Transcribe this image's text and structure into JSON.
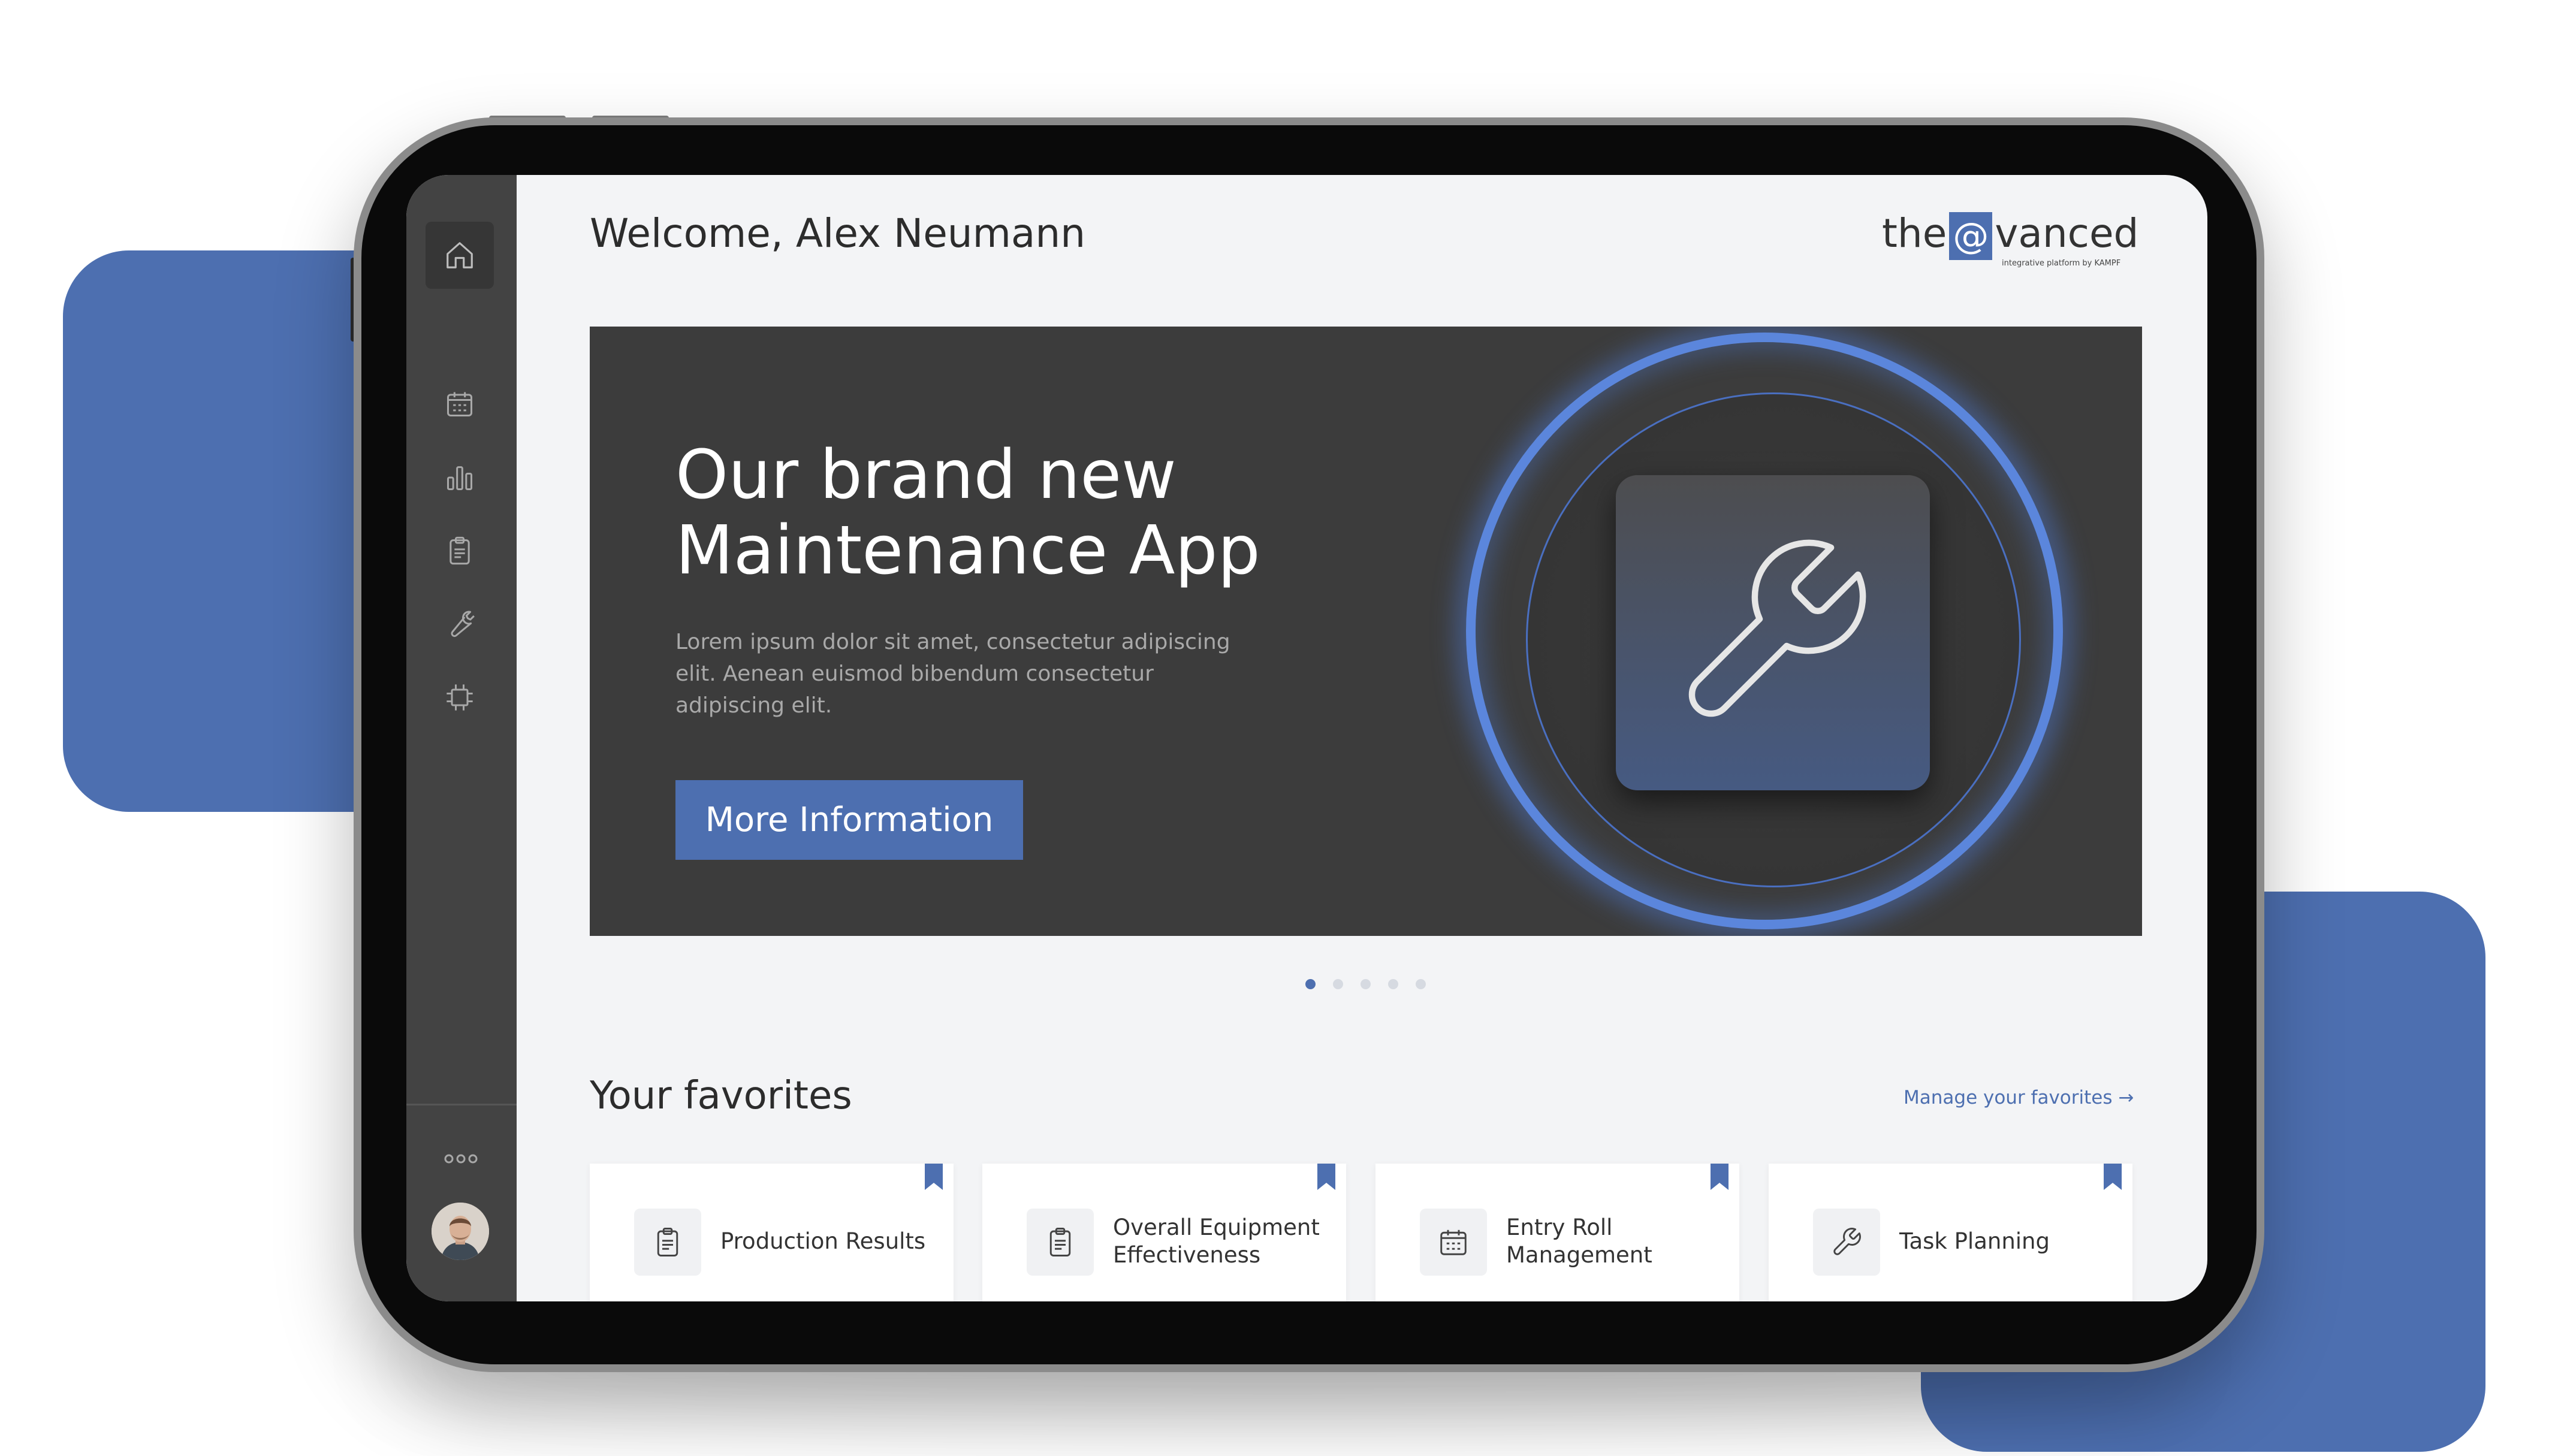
{
  "theme": {
    "accent": "#4d6fb0",
    "sidebar_bg": "#434343",
    "hero_bg": "#3c3c3c",
    "glow": "#5b86dc"
  },
  "sidebar": {
    "items": [
      {
        "name": "home",
        "icon": "home-icon"
      },
      {
        "name": "calendar",
        "icon": "calendar-icon"
      },
      {
        "name": "charts",
        "icon": "bar-chart-icon"
      },
      {
        "name": "reports",
        "icon": "clipboard-icon"
      },
      {
        "name": "maintenance",
        "icon": "wrench-icon"
      },
      {
        "name": "devices",
        "icon": "chip-icon"
      }
    ],
    "more_icon": "more-icon",
    "avatar_icon": "user-avatar"
  },
  "header": {
    "welcome": "Welcome, Alex Neumann",
    "logo": {
      "prefix": "the",
      "at": "@",
      "suffix": "vanced",
      "tagline": "integrative platform by KAMPF"
    }
  },
  "hero": {
    "title_line1": "Our brand new",
    "title_line2": "Maintenance App",
    "text": "Lorem ipsum dolor sit amet, consectetur adipiscing elit. Aenean euismod bibendum consectetur adipiscing elit.",
    "button": "More Information",
    "icon": "wrench-icon"
  },
  "carousel": {
    "count": 5,
    "active": 1
  },
  "favorites": {
    "title": "Your favorites",
    "manage": "Manage your favorites →",
    "items": [
      {
        "label": "Production Results",
        "icon": "clipboard-icon"
      },
      {
        "label": "Overall Equipment Effectiveness",
        "icon": "clipboard-icon"
      },
      {
        "label": "Entry Roll Management",
        "icon": "calendar-icon"
      },
      {
        "label": "Task Planning",
        "icon": "wrench-icon"
      }
    ]
  }
}
